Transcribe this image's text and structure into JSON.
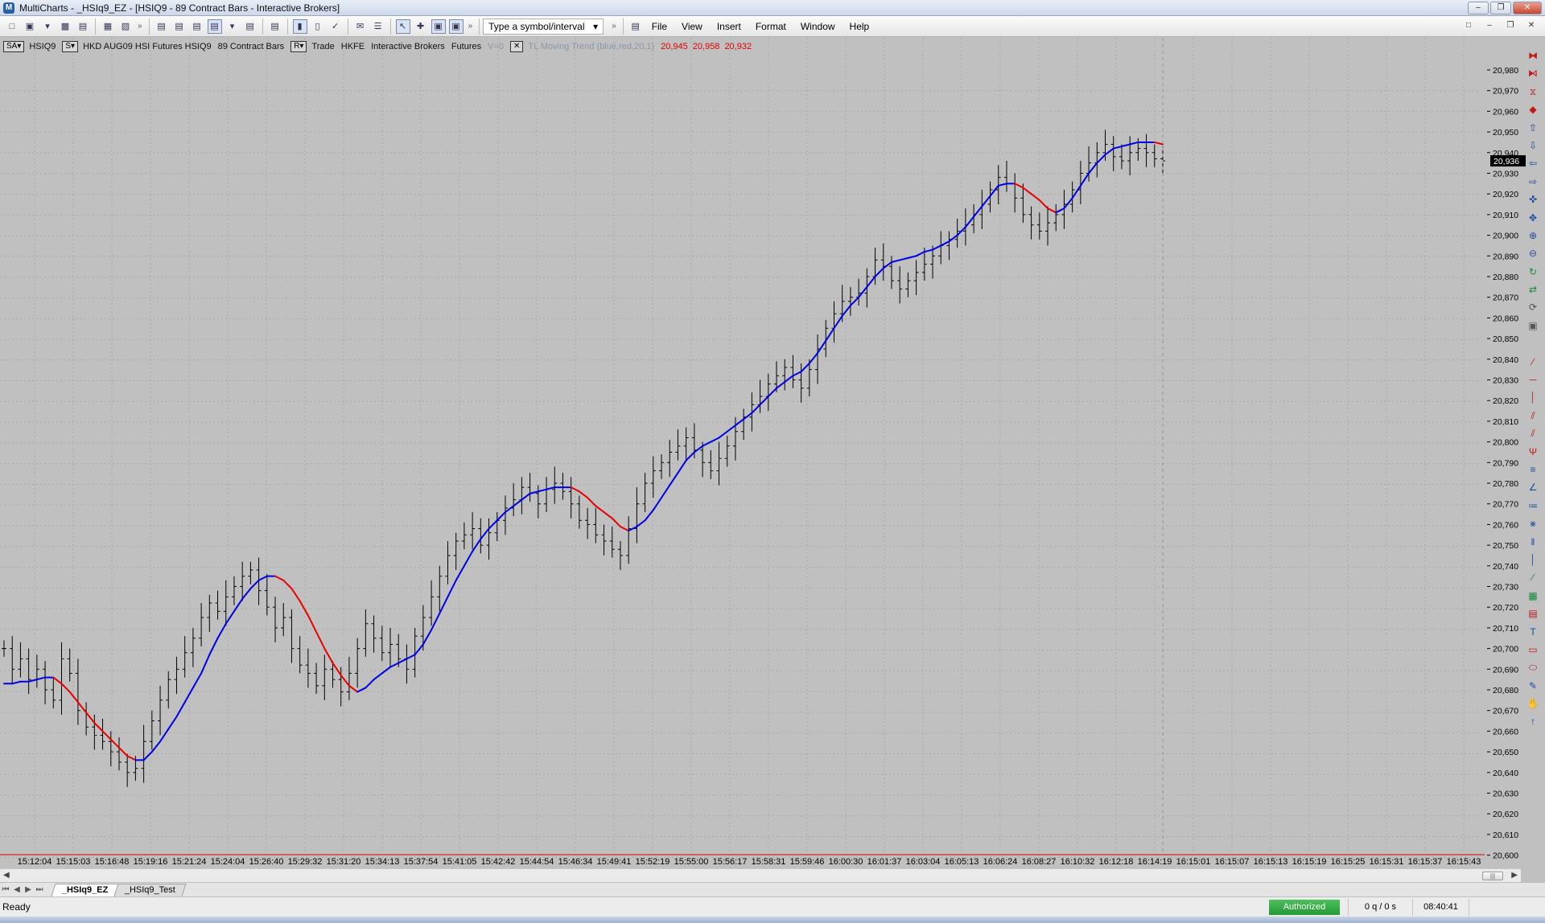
{
  "window": {
    "title": "MultiCharts - _HSIq9_EZ - [HSIQ9 - 89 Contract Bars - Interactive Brokers]",
    "app_icon": "multicharts-logo-icon",
    "controls": {
      "minimize": "–",
      "restore": "❐",
      "close": "✕"
    }
  },
  "toolbar": {
    "symbol_placeholder": "Type a symbol/interval",
    "more_glyph": "»",
    "menu": [
      "File",
      "View",
      "Insert",
      "Format",
      "Window",
      "Help"
    ]
  },
  "status_line": {
    "chip1": "SA▾",
    "symbol": "HSIQ9",
    "chip2": "S▾",
    "description": "HKD AUG09 HSI Futures HSIQ9",
    "bars": "89 Contract Bars",
    "chip3": "R▾",
    "data_type": "Trade",
    "exchange": "HKFE",
    "broker": "Interactive Brokers",
    "category": "Futures",
    "volume": "V=0",
    "indicator": "TL Moving Trend  (blue,red,20,1)",
    "values": [
      "20,945",
      "20,958",
      "20,932"
    ]
  },
  "chart": {
    "last_price": "20,936",
    "colors": {
      "background": "#c0c0c0",
      "bars": "#000000",
      "trend_up": "#0000e6",
      "trend_down": "#e60000",
      "axis_line": "#d40000",
      "price_tag_bg": "#000000",
      "grid": "#a8a8a8"
    },
    "price_axis": {
      "labels": [
        "20,980",
        "20,970",
        "20,960",
        "20,950",
        "20,940",
        "20,930",
        "20,920",
        "20,910",
        "20,900",
        "20,890",
        "20,880",
        "20,870",
        "20,860",
        "20,850",
        "20,840",
        "20,830",
        "20,820",
        "20,810",
        "20,800",
        "20,790",
        "20,780",
        "20,770",
        "20,760",
        "20,750",
        "20,740",
        "20,730",
        "20,720",
        "20,710",
        "20,700",
        "20,690",
        "20,680",
        "20,670",
        "20,660",
        "20,650",
        "20,640",
        "20,630",
        "20,620",
        "20,610",
        "20,600"
      ]
    },
    "time_axis": {
      "labels": [
        "15:12:04",
        "15:15:03",
        "15:16:48",
        "15:19:16",
        "15:21:24",
        "15:24:04",
        "15:26:40",
        "15:29:32",
        "15:31:20",
        "15:34:13",
        "15:37:54",
        "15:41:05",
        "15:42:42",
        "15:44:54",
        "15:46:34",
        "15:49:41",
        "15:52:19",
        "15:55:00",
        "15:56:17",
        "15:58:31",
        "15:59:46",
        "16:00:30",
        "16:01:37",
        "16:03:04",
        "16:05:13",
        "16:06:24",
        "16:08:27",
        "16:10:32",
        "16:12:18",
        "16:14:19",
        "16:15:01",
        "16:15:07",
        "16:15:13",
        "16:15:19",
        "16:15:25",
        "16:15:31",
        "16:15:37",
        "16:15:43"
      ]
    }
  },
  "chart_data": {
    "type": "line",
    "series": [
      {
        "name": "HSIQ9",
        "values": [
          20700,
          20690,
          20695,
          20685,
          20690,
          20680,
          20675,
          20695,
          20688,
          20670,
          20662,
          20658,
          20655,
          20650,
          20645,
          20640,
          20642,
          20655,
          20665,
          20675,
          20685,
          20690,
          20698,
          20705,
          20715,
          20722,
          20718,
          20725,
          20730,
          20735,
          20738,
          20728,
          20720,
          20710,
          20715,
          20700,
          20692,
          20688,
          20682,
          20690,
          20685,
          20679,
          20688,
          20700,
          20712,
          20705,
          20698,
          20702,
          20695,
          20690,
          20706,
          20715,
          20725,
          20735,
          20745,
          20752,
          20755,
          20758,
          20750,
          20756,
          20762,
          20768,
          20772,
          20778,
          20775,
          20770,
          20777,
          20780,
          20776,
          20770,
          20762,
          20760,
          20755,
          20752,
          20748,
          20745,
          20758,
          20770,
          20780,
          20786,
          20790,
          20795,
          20798,
          20802,
          20796,
          20790,
          20786,
          20792,
          20798,
          20805,
          20812,
          20818,
          20822,
          20828,
          20832,
          20836,
          20830,
          20826,
          20835,
          20845,
          20855,
          20862,
          20868,
          20870,
          20872,
          20880,
          20888,
          20885,
          20878,
          20874,
          20878,
          20882,
          20886,
          20890,
          20895,
          20898,
          20902,
          20905,
          20910,
          20915,
          20922,
          20928,
          20925,
          20918,
          20910,
          20905,
          20902,
          20906,
          20910,
          20915,
          20922,
          20930,
          20935,
          20940,
          20944,
          20938,
          20936,
          20940,
          20942,
          20940,
          20937,
          20936
        ]
      },
      {
        "name": "TL Moving Trend",
        "values": [
          20683,
          20683,
          20684,
          20684,
          20685,
          20686,
          20686,
          20683,
          20679,
          20674,
          20669,
          20664,
          20660,
          20656,
          20652,
          20648,
          20646,
          20646,
          20650,
          20655,
          20661,
          20667,
          20674,
          20681,
          20688,
          20697,
          20705,
          20712,
          20718,
          20724,
          20729,
          20733,
          20735,
          20735,
          20733,
          20729,
          20723,
          20716,
          20708,
          20700,
          20693,
          20687,
          20682,
          20679,
          20681,
          20685,
          20688,
          20691,
          20693,
          20695,
          20697,
          20702,
          20709,
          20717,
          20725,
          20733,
          20740,
          20747,
          20753,
          20758,
          20762,
          20766,
          20769,
          20772,
          20775,
          20776,
          20777,
          20778,
          20778,
          20778,
          20776,
          20773,
          20769,
          20766,
          20763,
          20759,
          20757,
          20759,
          20762,
          20767,
          20773,
          20779,
          20785,
          20791,
          20795,
          20798,
          20800,
          20802,
          20805,
          20808,
          20811,
          20814,
          20818,
          20822,
          20826,
          20829,
          20832,
          20834,
          20838,
          20843,
          20849,
          20855,
          20861,
          20866,
          20870,
          20875,
          20880,
          20884,
          20887,
          20888,
          20889,
          20890,
          20892,
          20893,
          20895,
          20897,
          20900,
          20904,
          20909,
          20914,
          20919,
          20924,
          20925,
          20925,
          20923,
          20920,
          20917,
          20913,
          20911,
          20913,
          20918,
          20924,
          20930,
          20935,
          20939,
          20942,
          20943,
          20944,
          20945,
          20945,
          20945,
          20944
        ],
        "colors_by_segment": {
          "rising": "#0000e6",
          "falling": "#e60000"
        }
      }
    ],
    "ylim": [
      20600,
      20990
    ],
    "xlabel": "",
    "ylabel": "",
    "grid": true
  },
  "right_toolbar": {
    "icons": [
      {
        "name": "bowtie-icon",
        "glyph": "⧓",
        "tone": "red"
      },
      {
        "name": "arrows-in-icon",
        "glyph": "⧑",
        "tone": "red"
      },
      {
        "name": "hourglass-icon",
        "glyph": "⧖",
        "tone": "red"
      },
      {
        "name": "diamond-icon",
        "glyph": "◆",
        "tone": "red"
      },
      {
        "name": "arrow-up-icon",
        "glyph": "⇧",
        "tone": "blue"
      },
      {
        "name": "arrow-down-icon",
        "glyph": "⇩",
        "tone": "blue"
      },
      {
        "name": "arrow-left-icon",
        "glyph": "⇦",
        "tone": "blue"
      },
      {
        "name": "arrow-right-icon",
        "glyph": "⇨",
        "tone": "blue"
      },
      {
        "name": "crosshair-icon",
        "glyph": "✜",
        "tone": "blue"
      },
      {
        "name": "move-icon",
        "glyph": "✥",
        "tone": "blue"
      },
      {
        "name": "zoom-in-icon",
        "glyph": "⊕",
        "tone": "blue"
      },
      {
        "name": "zoom-out-icon",
        "glyph": "⊖",
        "tone": "blue"
      },
      {
        "name": "refresh-icon",
        "glyph": "↻",
        "tone": "green"
      },
      {
        "name": "compare-icon",
        "glyph": "⇄",
        "tone": "green"
      },
      {
        "name": "cycle-icon",
        "glyph": "⟳",
        "tone": "gray"
      },
      {
        "name": "monitor-icon",
        "glyph": "▣",
        "tone": "gray"
      },
      {
        "name": "spacer",
        "glyph": " ",
        "tone": "gray"
      },
      {
        "name": "trendline-icon",
        "glyph": "∕",
        "tone": "red"
      },
      {
        "name": "horizontal-line-icon",
        "glyph": "─",
        "tone": "red"
      },
      {
        "name": "vertical-line-icon",
        "glyph": "│",
        "tone": "red"
      },
      {
        "name": "parallel-channel-icon",
        "glyph": "⫽",
        "tone": "red"
      },
      {
        "name": "regression-channel-icon",
        "glyph": "⫽",
        "tone": "red"
      },
      {
        "name": "pitchfork-icon",
        "glyph": "Ψ",
        "tone": "red"
      },
      {
        "name": "fibonacci-retracement-icon",
        "glyph": "≡",
        "tone": "blue"
      },
      {
        "name": "fibonacci-fan-icon",
        "glyph": "∠",
        "tone": "blue"
      },
      {
        "name": "fibonacci-arc-icon",
        "glyph": "≔",
        "tone": "blue"
      },
      {
        "name": "gann-fan-icon",
        "glyph": "⨳",
        "tone": "blue"
      },
      {
        "name": "cycle-lines-icon",
        "glyph": "‖",
        "tone": "blue"
      },
      {
        "name": "time-zones-icon",
        "glyph": "│",
        "tone": "blue"
      },
      {
        "name": "speed-lines-icon",
        "glyph": "∕",
        "tone": "green"
      },
      {
        "name": "grid-icon",
        "glyph": "▦",
        "tone": "green"
      },
      {
        "name": "text-box-icon",
        "glyph": "▤",
        "tone": "red"
      },
      {
        "name": "text-icon",
        "glyph": "T",
        "tone": "blue"
      },
      {
        "name": "rectangle-icon",
        "glyph": "▭",
        "tone": "red"
      },
      {
        "name": "ellipse-icon",
        "glyph": "⬭",
        "tone": "red"
      },
      {
        "name": "pencil-icon",
        "glyph": "✎",
        "tone": "blue"
      },
      {
        "name": "hand-icon",
        "glyph": "✋",
        "tone": "red"
      },
      {
        "name": "arrow-marker-icon",
        "glyph": "↑",
        "tone": "blue"
      }
    ]
  },
  "tabs": {
    "nav": [
      "⏮",
      "◀",
      "▶",
      "⏭"
    ],
    "items": [
      "_HSIq9_EZ",
      "_HSIq9_Test"
    ]
  },
  "status_bar": {
    "text": "Ready",
    "auth": "Authorized",
    "queue": "0 q / 0 s",
    "time": "08:40:41"
  }
}
